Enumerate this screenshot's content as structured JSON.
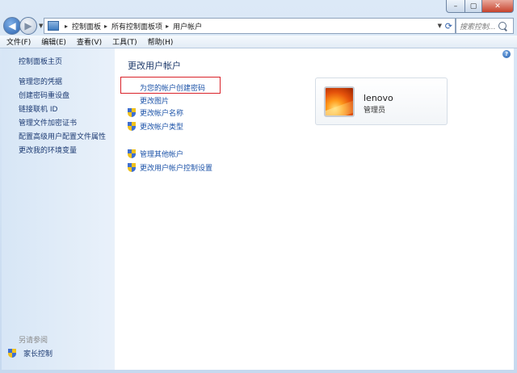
{
  "window": {
    "minimize_icon": "minimize-icon",
    "maximize_icon": "maximize-icon",
    "close_icon": "close-icon",
    "minimize_glyph": "–",
    "maximize_glyph": "▢",
    "close_glyph": "✕"
  },
  "address_bar": {
    "breadcrumbs": [
      "控制面板",
      "所有控制面板项",
      "用户帐户"
    ],
    "separator": "▸",
    "search_placeholder": "搜索控制..."
  },
  "menu": [
    "文件(F)",
    "编辑(E)",
    "查看(V)",
    "工具(T)",
    "帮助(H)"
  ],
  "sidebar": {
    "items": [
      "控制面板主页",
      "管理您的凭据",
      "创建密码重设盘",
      "链接联机 ID",
      "管理文件加密证书",
      "配置高级用户配置文件属性",
      "更改我的环境变量"
    ],
    "see_also_title": "另请参阅",
    "see_also_items": [
      "家长控制"
    ]
  },
  "main": {
    "title": "更改用户帐户",
    "tasks": [
      "为您的帐户创建密码",
      "更改图片",
      "更改帐户名称",
      "更改帐户类型"
    ],
    "tasks2": [
      "管理其他帐户",
      "更改用户帐户控制设置"
    ],
    "help_glyph": "?"
  },
  "user": {
    "name": "lenovo",
    "role": "管理员"
  },
  "colors": {
    "highlight_box": "#d9222a",
    "link": "#1c53a8"
  }
}
